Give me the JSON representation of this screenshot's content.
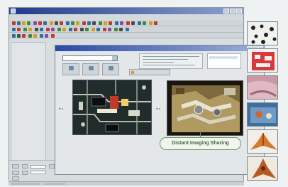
{
  "dialog": {
    "sharing_label": "Distant Imaging Sharing"
  },
  "colors": {
    "accent_label": "#3a6a3a",
    "label_border": "#6a9a5a",
    "title_bar": "#1f3a8a"
  },
  "icons": [
    "app-icon",
    "toolbar-icons",
    "minimize-icon",
    "maximize-icon",
    "close-icon"
  ]
}
